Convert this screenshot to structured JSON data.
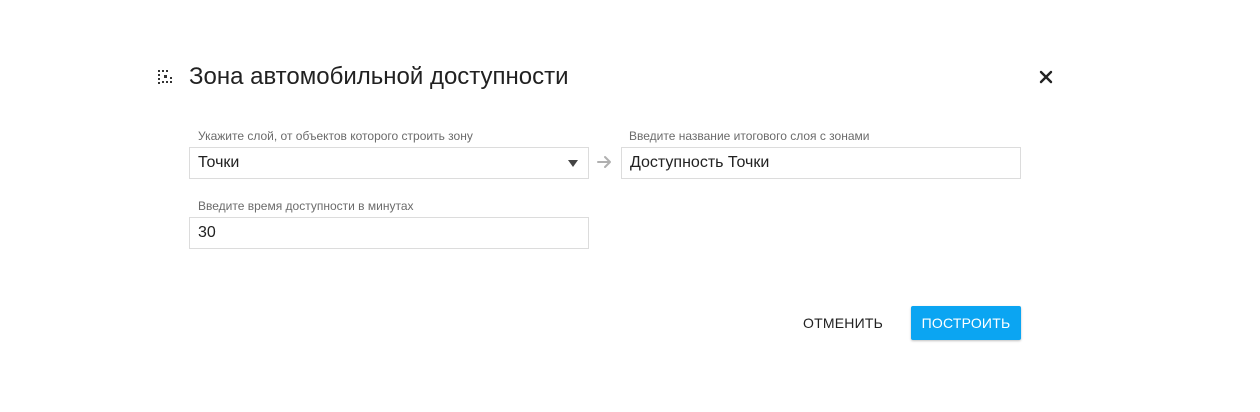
{
  "dialog": {
    "title": "Зона автомобильной доступности",
    "icon": "zone-grid-icon",
    "close_icon": "close-icon"
  },
  "form": {
    "source_layer": {
      "label": "Укажите слой, от объектов которого строить зону",
      "value": "Точки"
    },
    "result_layer": {
      "label": "Введите название итогового слоя с зонами",
      "value": "Доступность Точки"
    },
    "time": {
      "label": "Введите время доступности в минутах",
      "value": "30"
    }
  },
  "actions": {
    "cancel_label": "ОТМЕНИТЬ",
    "build_label": "ПОСТРОИТЬ"
  },
  "colors": {
    "primary": "#0ba5f2",
    "text": "#212121",
    "label": "#6b6b6b",
    "border": "#dcdcdc"
  }
}
